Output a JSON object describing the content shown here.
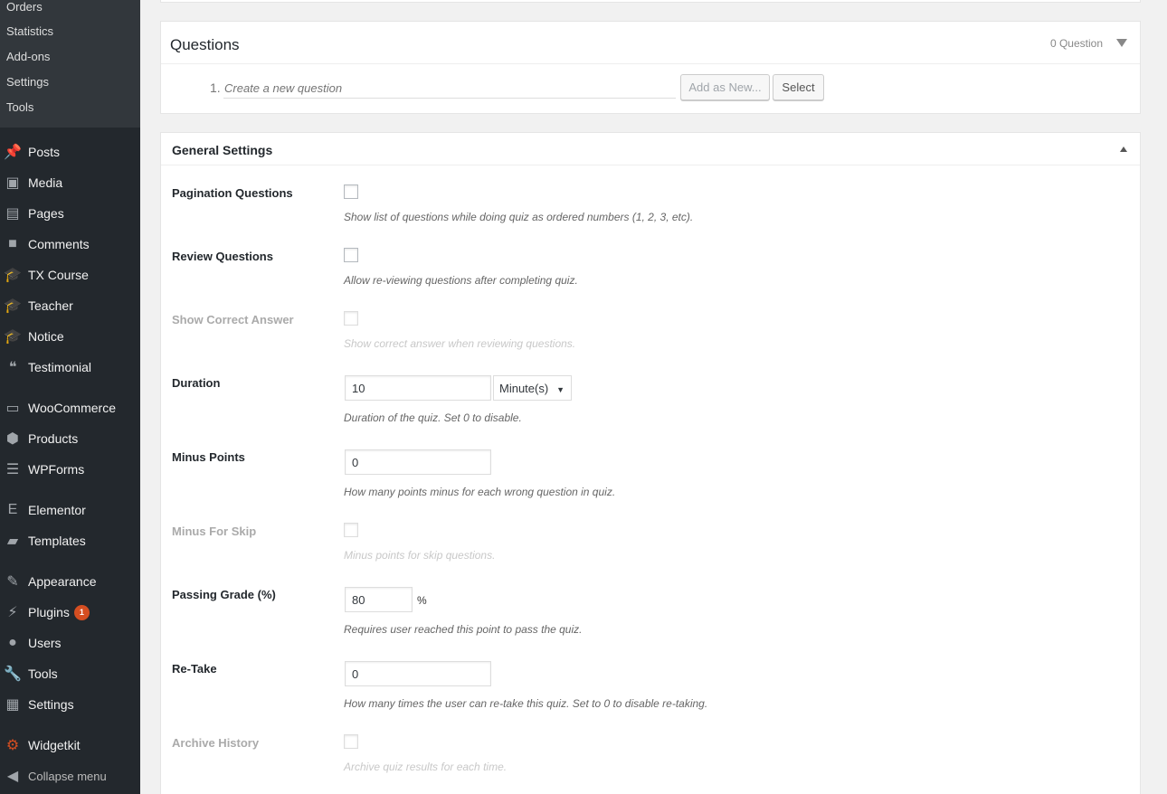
{
  "sidebar": {
    "submenu": [
      "Orders",
      "Statistics",
      "Add-ons",
      "Settings",
      "Tools"
    ],
    "items": [
      {
        "label": "Posts",
        "icon": "pushpin-icon",
        "glyph": "📌"
      },
      {
        "label": "Media",
        "icon": "media-icon",
        "glyph": "▣"
      },
      {
        "label": "Pages",
        "icon": "pages-icon",
        "glyph": "▤"
      },
      {
        "label": "Comments",
        "icon": "comment-icon",
        "glyph": "■"
      },
      {
        "label": "TX Course",
        "icon": "graduation-cap-icon",
        "glyph": "🎓"
      },
      {
        "label": "Teacher",
        "icon": "graduation-cap-icon",
        "glyph": "🎓"
      },
      {
        "label": "Notice",
        "icon": "graduation-cap-icon",
        "glyph": "🎓"
      },
      {
        "label": "Testimonial",
        "icon": "quote-icon",
        "glyph": "❝"
      },
      {
        "label": "WooCommerce",
        "icon": "woocommerce-icon",
        "glyph": "▭"
      },
      {
        "label": "Products",
        "icon": "box-icon",
        "glyph": "⬢"
      },
      {
        "label": "WPForms",
        "icon": "form-icon",
        "glyph": "☰"
      },
      {
        "label": "Elementor",
        "icon": "elementor-icon",
        "glyph": "E"
      },
      {
        "label": "Templates",
        "icon": "folder-icon",
        "glyph": "▰"
      },
      {
        "label": "Appearance",
        "icon": "brush-icon",
        "glyph": "✎"
      },
      {
        "label": "Plugins",
        "icon": "plug-icon",
        "glyph": "⚡",
        "badge": "1"
      },
      {
        "label": "Users",
        "icon": "user-icon",
        "glyph": "●"
      },
      {
        "label": "Tools",
        "icon": "wrench-icon",
        "glyph": "🔧"
      },
      {
        "label": "Settings",
        "icon": "settings-icon",
        "glyph": "▦"
      },
      {
        "label": "Widgetkit",
        "icon": "widgetkit-icon",
        "glyph": "⚙"
      },
      {
        "label": "Collapse menu",
        "icon": "collapse-icon",
        "glyph": "◀"
      }
    ]
  },
  "questions": {
    "title": "Questions",
    "count": "0 Question",
    "new_number": "1.",
    "new_placeholder": "Create a new question",
    "add_new_label": "Add as New...",
    "select_label": "Select"
  },
  "general": {
    "title": "General Settings",
    "rows": [
      {
        "label": "Pagination Questions",
        "desc": "Show list of questions while doing quiz as ordered numbers (1, 2, 3, etc)."
      },
      {
        "label": "Review Questions",
        "desc": "Allow re-viewing questions after completing quiz."
      },
      {
        "label": "Show Correct Answer",
        "desc": "Show correct answer when reviewing questions."
      },
      {
        "label": "Duration",
        "desc": "Duration of the quiz. Set 0 to disable.",
        "value": "10",
        "unit_select": "Minute(s)"
      },
      {
        "label": "Minus Points",
        "desc": "How many points minus for each wrong question in quiz.",
        "value": "0"
      },
      {
        "label": "Minus For Skip",
        "desc": "Minus points for skip questions."
      },
      {
        "label": "Passing Grade (%)",
        "desc": "Requires user reached this point to pass the quiz.",
        "value": "80",
        "unit": "%"
      },
      {
        "label": "Re-Take",
        "desc": "How many times the user can re-take this quiz. Set to 0 to disable re-taking.",
        "value": "0"
      },
      {
        "label": "Archive History",
        "desc": "Archive quiz results for each time."
      }
    ]
  },
  "colors": {
    "sidebar_bg": "#23282d",
    "submenu_bg": "#32373c",
    "badge": "#d54e21"
  }
}
